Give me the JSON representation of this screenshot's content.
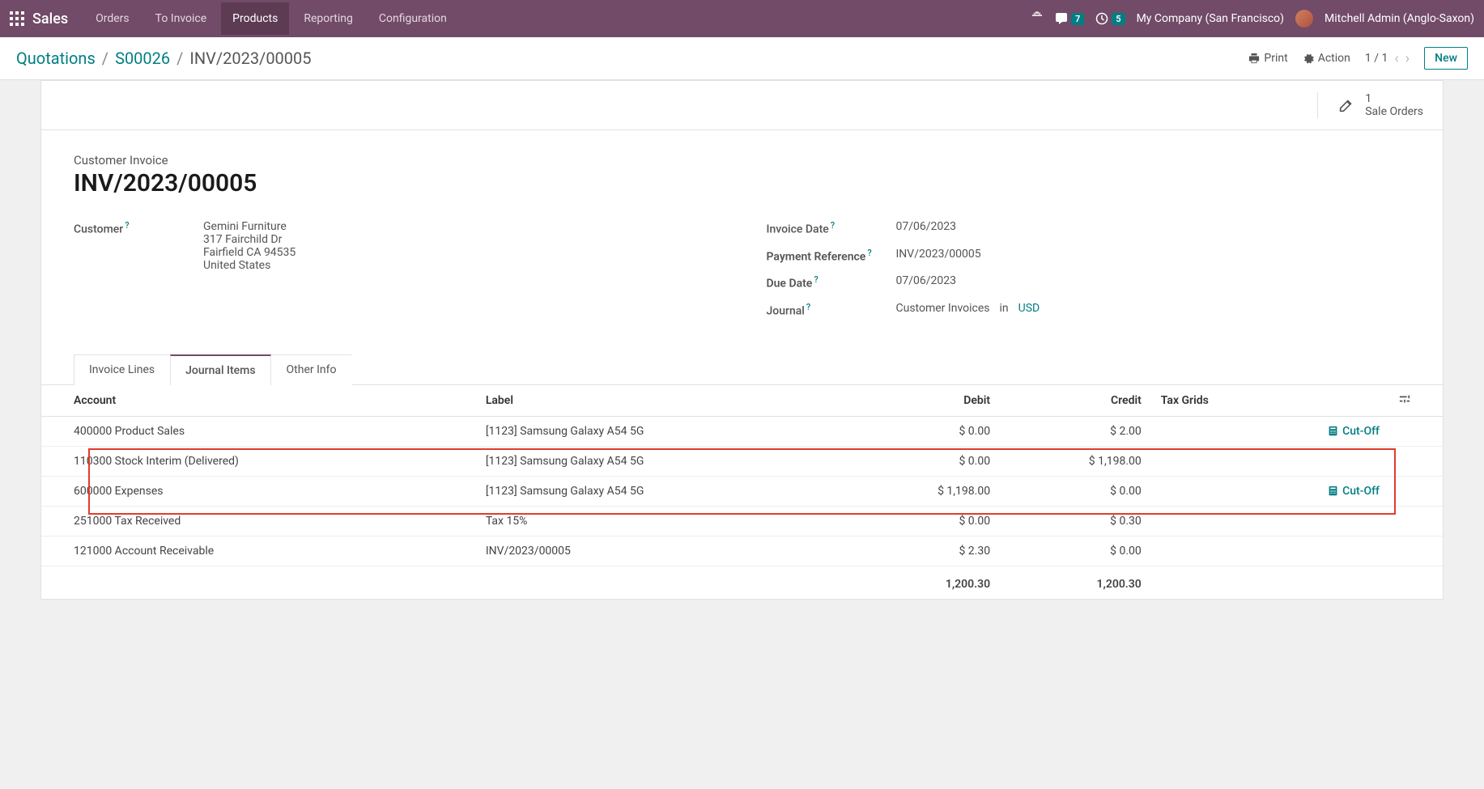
{
  "topbar": {
    "brand": "Sales",
    "nav": [
      "Orders",
      "To Invoice",
      "Products",
      "Reporting",
      "Configuration"
    ],
    "active_nav": 2,
    "msg_badge": "7",
    "act_badge": "5",
    "company": "My Company (San Francisco)",
    "user": "Mitchell Admin (Anglo-Saxon)"
  },
  "controlbar": {
    "breadcrumb": [
      {
        "label": "Quotations",
        "link": true
      },
      {
        "label": "S00026",
        "link": true
      },
      {
        "label": "INV/2023/00005",
        "link": false
      }
    ],
    "print": "Print",
    "action": "Action",
    "pager": "1 / 1",
    "new_btn": "New"
  },
  "stat": {
    "num": "1",
    "label": "Sale Orders"
  },
  "doc": {
    "type_label": "Customer Invoice",
    "title": "INV/2023/00005",
    "customer_label": "Customer",
    "customer_name": "Gemini Furniture",
    "addr1": "317 Fairchild Dr",
    "addr2": "Fairfield CA 94535",
    "addr3": "United States",
    "invdate_label": "Invoice Date",
    "invdate": "07/06/2023",
    "payref_label": "Payment Reference",
    "payref": "INV/2023/00005",
    "duedate_label": "Due Date",
    "duedate": "07/06/2023",
    "journal_label": "Journal",
    "journal": "Customer Invoices",
    "in": "in",
    "currency": "USD"
  },
  "tabs": [
    "Invoice Lines",
    "Journal Items",
    "Other Info"
  ],
  "active_tab": 1,
  "table": {
    "headers": {
      "account": "Account",
      "label": "Label",
      "debit": "Debit",
      "credit": "Credit",
      "tax": "Tax Grids"
    },
    "rows": [
      {
        "account": "400000 Product Sales",
        "label": "[1123] Samsung Galaxy A54 5G",
        "debit": "$ 0.00",
        "credit": "$ 2.00",
        "cutoff": true
      },
      {
        "account": "110300 Stock Interim (Delivered)",
        "label": "[1123] Samsung Galaxy A54 5G",
        "debit": "$ 0.00",
        "credit": "$ 1,198.00",
        "cutoff": false
      },
      {
        "account": "600000 Expenses",
        "label": "[1123] Samsung Galaxy A54 5G",
        "debit": "$ 1,198.00",
        "credit": "$ 0.00",
        "cutoff": true
      },
      {
        "account": "251000 Tax Received",
        "label": "Tax 15%",
        "debit": "$ 0.00",
        "credit": "$ 0.30",
        "cutoff": false
      },
      {
        "account": "121000 Account Receivable",
        "label": "INV/2023/00005",
        "debit": "$ 2.30",
        "credit": "$ 0.00",
        "cutoff": false
      }
    ],
    "totals": {
      "debit": "1,200.30",
      "credit": "1,200.30"
    },
    "cutoff_label": "Cut-Off"
  }
}
